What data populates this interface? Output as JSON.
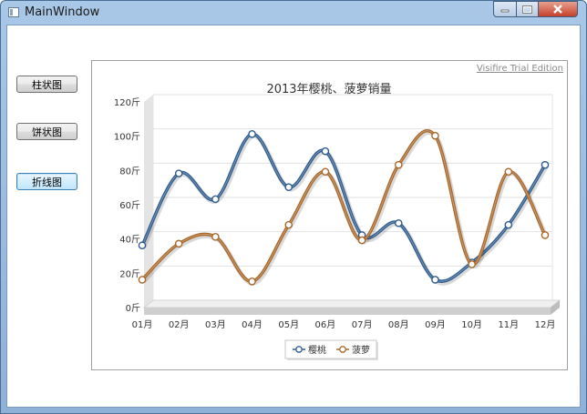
{
  "window": {
    "title": "MainWindow"
  },
  "buttons": {
    "bar": "柱状图",
    "pie": "饼状图",
    "line": "折线图"
  },
  "chart": {
    "watermark": "Visifire Trial Edition"
  },
  "chart_data": {
    "type": "line",
    "title": "2013年樱桃、菠萝销量",
    "categories": [
      "01月",
      "02月",
      "03月",
      "04月",
      "05月",
      "06月",
      "07月",
      "08月",
      "09月",
      "10月",
      "11月",
      "12月"
    ],
    "y_ticks": [
      "0斤",
      "20斤",
      "40斤",
      "60斤",
      "80斤",
      "100斤",
      "120斤"
    ],
    "ylim": [
      0,
      120
    ],
    "grid": true,
    "legend_position": "bottom-center",
    "series": [
      {
        "name": "樱桃",
        "color": "#2f5c8f",
        "values": [
          32,
          74,
          59,
          97,
          66,
          87,
          38,
          45,
          12,
          22,
          44,
          79
        ]
      },
      {
        "name": "菠萝",
        "color": "#a9682a",
        "values": [
          12,
          33,
          37,
          11,
          44,
          75,
          35,
          79,
          96,
          21,
          75,
          38
        ]
      }
    ]
  }
}
